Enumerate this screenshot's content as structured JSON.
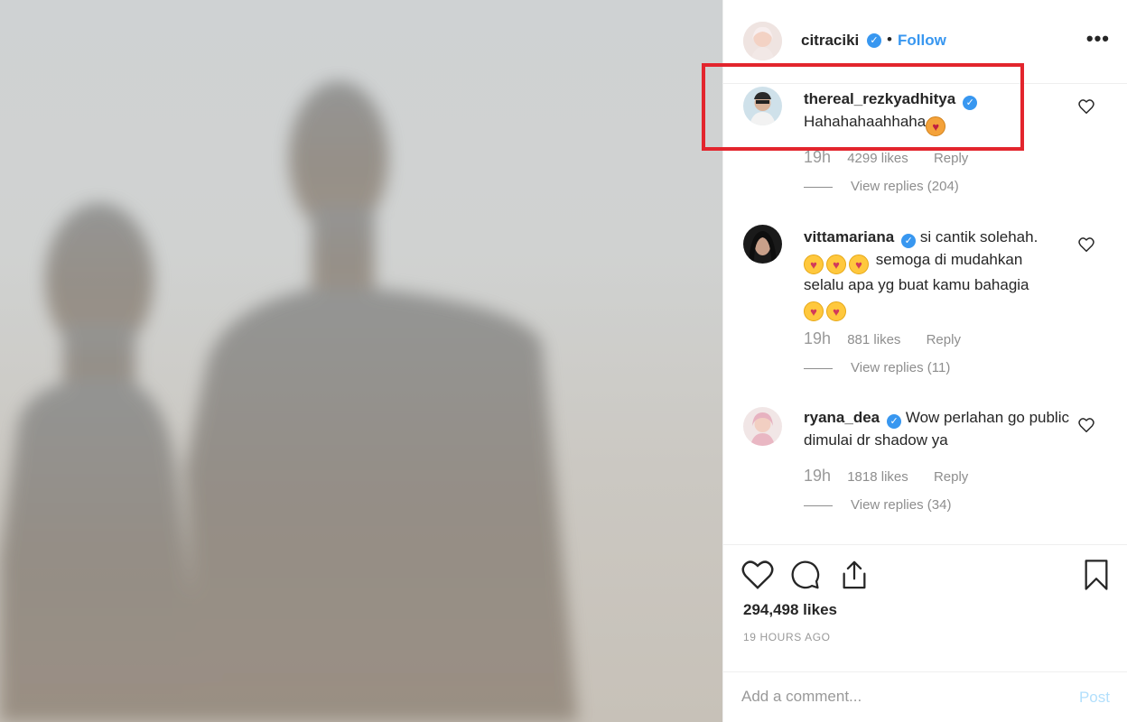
{
  "post_author": {
    "username": "citraciki",
    "verified": true,
    "separator": "•",
    "follow_label": "Follow",
    "more_label": "•••"
  },
  "comments": [
    {
      "username": "thereal_rezkyadhitya",
      "verified": true,
      "text": "Hahahahaahhaha",
      "emojis": [
        "heart-eyes-cat"
      ],
      "time": "19h",
      "likes": "4299 likes",
      "reply_label": "Reply",
      "view_replies": "View replies (204)"
    },
    {
      "username": "vittamariana",
      "verified": true,
      "text_lines": [
        "si cantik solehah.",
        "semoga di mudahkan",
        "selalu apa yg buat kamu bahagia"
      ],
      "emojis": [
        "kissing-heart",
        "kissing-heart",
        "kissing-heart",
        "kissing-heart",
        "kissing-heart"
      ],
      "time": "19h",
      "likes": "881 likes",
      "reply_label": "Reply",
      "view_replies": "View replies (11)"
    },
    {
      "username": "ryana_dea",
      "verified": true,
      "text": "Wow perlahan go public dimulai dr shadow ya",
      "time": "19h",
      "likes": "1818 likes",
      "reply_label": "Reply",
      "view_replies": "View replies (34)"
    }
  ],
  "post_stats": {
    "likes": "294,498 likes",
    "time_ago": "19 HOURS AGO"
  },
  "add_comment": {
    "placeholder": "Add a comment...",
    "post_label": "Post"
  },
  "icons": {
    "like": "heart-icon",
    "comment": "comment-bubble-icon",
    "share": "share-icon",
    "save": "bookmark-icon",
    "verified": "verified-badge-icon",
    "more": "more-options-icon"
  },
  "colors": {
    "link": "#3897f0",
    "highlight": "#e3252d",
    "muted": "#8e8e8e",
    "post_disabled": "#b2dffc"
  }
}
